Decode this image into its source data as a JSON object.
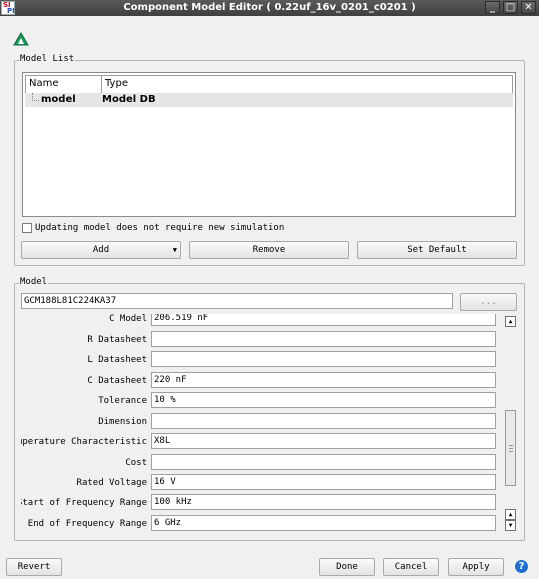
{
  "window": {
    "title": "Component Model Editor ( 0.22uf_16v_0201_c0201 )",
    "app_icon_text_1": "SI",
    "app_icon_text_2": "PI",
    "minimize": "_",
    "maximize": "□",
    "close": "✕"
  },
  "toolbar": {
    "icon": "app-logo-icon"
  },
  "model_list": {
    "title": "Model List",
    "columns": [
      "Name",
      "Type"
    ],
    "rows": [
      {
        "name": "model",
        "type": "Model DB"
      }
    ],
    "checkbox_label": "Updating model does not require new simulation",
    "checkbox_checked": false,
    "add_label": "Add",
    "remove_label": "Remove",
    "set_default_label": "Set Default"
  },
  "model": {
    "title": "Model",
    "name_value": "GCM188L81C224KA37",
    "browse_label": "...",
    "properties": [
      {
        "label": "C Model",
        "value": "206.519 nF"
      },
      {
        "label": "R Datasheet",
        "value": ""
      },
      {
        "label": "L Datasheet",
        "value": ""
      },
      {
        "label": "C Datasheet",
        "value": "220 nF"
      },
      {
        "label": "Tolerance",
        "value": "10 %"
      },
      {
        "label": "Dimension",
        "value": ""
      },
      {
        "label": "Temperature Characteristic",
        "value": "X8L"
      },
      {
        "label": "Cost",
        "value": ""
      },
      {
        "label": "Rated Voltage",
        "value": "16 V"
      },
      {
        "label": "Start of Frequency Range",
        "value": "100 kHz"
      },
      {
        "label": "End of Frequency Range",
        "value": "6 GHz"
      }
    ]
  },
  "footer": {
    "revert_label": "Revert",
    "done_label": "Done",
    "cancel_label": "Cancel",
    "apply_label": "Apply",
    "help_icon": "?"
  }
}
